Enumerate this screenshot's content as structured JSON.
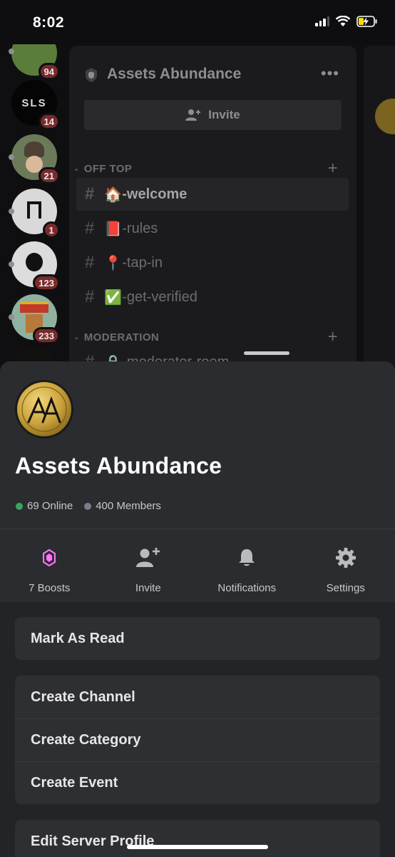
{
  "status_bar": {
    "time": "8:02"
  },
  "background": {
    "servers": [
      {
        "badge": "94",
        "label": ""
      },
      {
        "badge": "14",
        "label": "SLS"
      },
      {
        "badge": "21",
        "label": ""
      },
      {
        "badge": "1",
        "label": ""
      },
      {
        "badge": "123",
        "label": ""
      },
      {
        "badge": "233",
        "label": ""
      }
    ],
    "server_name": "Assets Abundance",
    "invite_label": "Invite",
    "categories": [
      "OFF TOP",
      "MODERATION"
    ],
    "channels": [
      {
        "name": "-welcome",
        "emoji": "🏠"
      },
      {
        "name": "-rules",
        "emoji": "📕"
      },
      {
        "name": "-tap-in",
        "emoji": "📍"
      },
      {
        "name": "-get-verified",
        "emoji": "✅"
      },
      {
        "name": "-moderator-room",
        "emoji": "🔒"
      }
    ]
  },
  "sheet": {
    "title": "Assets Abundance",
    "online": "69 Online",
    "members": "400 Members",
    "actions": [
      {
        "label": "7 Boosts",
        "icon": "boost-icon"
      },
      {
        "label": "Invite",
        "icon": "add-user-icon"
      },
      {
        "label": "Notifications",
        "icon": "bell-icon"
      },
      {
        "label": "Settings",
        "icon": "gear-icon"
      }
    ],
    "menu": {
      "mark_as_read": "Mark As Read",
      "create_channel": "Create Channel",
      "create_category": "Create Category",
      "create_event": "Create Event",
      "edit_server_profile": "Edit Server Profile"
    }
  },
  "colors": {
    "online": "#3ba55c",
    "members": "#747f8d",
    "boost": "#ff73fa",
    "sheet_bg": "#2b2c30",
    "card_bg": "#2e2f33"
  }
}
